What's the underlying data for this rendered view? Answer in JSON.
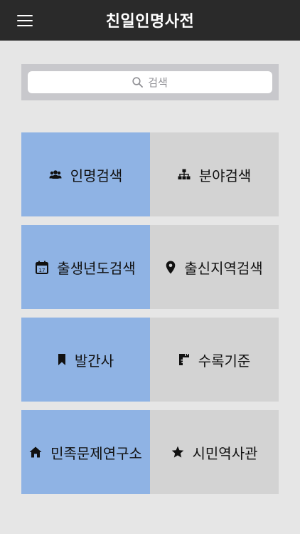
{
  "header": {
    "title": "친일인명사전",
    "menu_icon": "hamburger-icon"
  },
  "search": {
    "placeholder": "검색",
    "icon": "search-icon"
  },
  "colors": {
    "header_bg": "#2a2a2a",
    "tile_blue": "#8fb3e4",
    "tile_gray": "#d3d3d3",
    "page_bg": "#e6e6e6"
  },
  "menu": {
    "items": [
      {
        "label": "인명검색",
        "icon": "people-icon"
      },
      {
        "label": "분야검색",
        "icon": "hierarchy-icon"
      },
      {
        "label": "출생년도검색",
        "icon": "calendar-icon"
      },
      {
        "label": "출신지역검색",
        "icon": "location-pin-icon"
      },
      {
        "label": "발간사",
        "icon": "bookmark-icon"
      },
      {
        "label": "수록기준",
        "icon": "ruler-icon"
      },
      {
        "label": "민족문제연구소",
        "icon": "home-icon"
      },
      {
        "label": "시민역사관",
        "icon": "star-icon"
      }
    ]
  }
}
